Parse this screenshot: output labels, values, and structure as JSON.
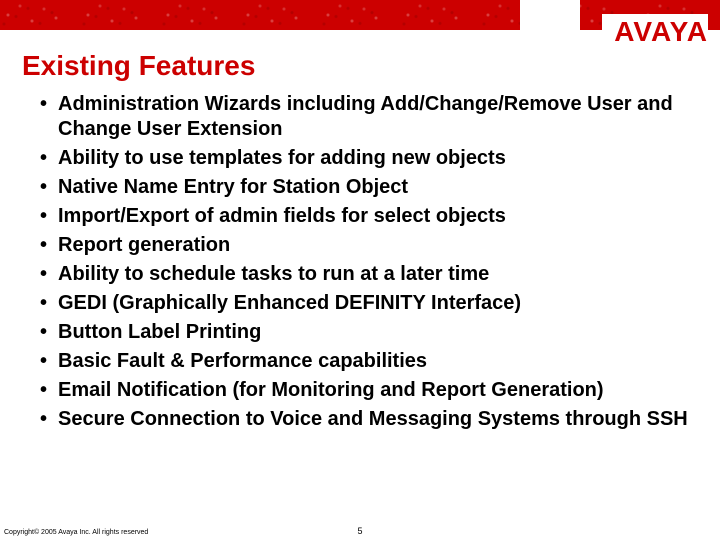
{
  "brand": "AVAYA",
  "title": "Existing Features",
  "bullets": [
    "Administration Wizards including Add/Change/Remove User and Change User Extension",
    "Ability to use templates for adding new objects",
    "Native Name Entry for Station Object",
    "Import/Export of admin fields for select objects",
    "Report generation",
    "Ability to schedule tasks to run at a later time",
    "GEDI (Graphically Enhanced DEFINITY Interface)",
    "Button Label Printing",
    "Basic Fault & Performance capabilities",
    "Email Notification (for Monitoring and Report Generation)",
    "Secure Connection to Voice and Messaging Systems through SSH"
  ],
  "footer": "Copyright© 2005 Avaya Inc. All rights reserved",
  "page_number": "5"
}
